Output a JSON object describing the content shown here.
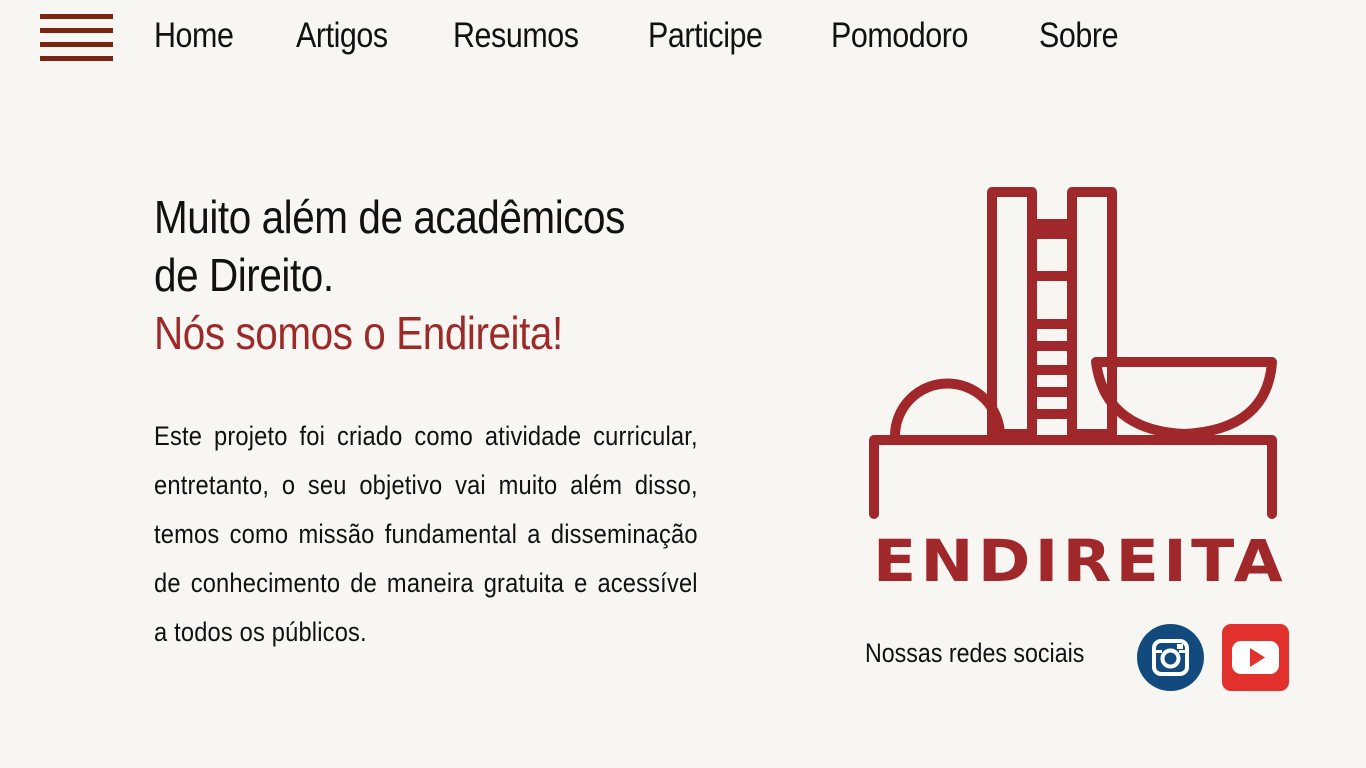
{
  "header": {
    "nav_items": [
      {
        "label": "Home"
      },
      {
        "label": "Artigos"
      },
      {
        "label": "Resumos"
      },
      {
        "label": "Participe"
      },
      {
        "label": "Pomodoro"
      },
      {
        "label": "Sobre"
      }
    ]
  },
  "hero": {
    "headline_line1": "Muito além de acadêmicos",
    "headline_line2": "de Direito.",
    "headline_accent": "Nós somos o Endireita!",
    "description": "Este projeto foi criado como atividade curricular, entretanto, o seu objetivo vai muito além disso, temos como missão fundamental a disseminação de conhecimento de maneira gratuita e acessível a todos os públicos."
  },
  "logo": {
    "wordmark": "ENDIREITA"
  },
  "social": {
    "label": "Nossas redes sociais",
    "links": [
      {
        "icon": "instagram-icon"
      },
      {
        "icon": "youtube-icon"
      }
    ]
  },
  "colors": {
    "background": "#f7f6f3",
    "accent": "#9b2a28",
    "menu": "#7a2412",
    "instagram": "#124a7e",
    "youtube": "#e2302c"
  }
}
